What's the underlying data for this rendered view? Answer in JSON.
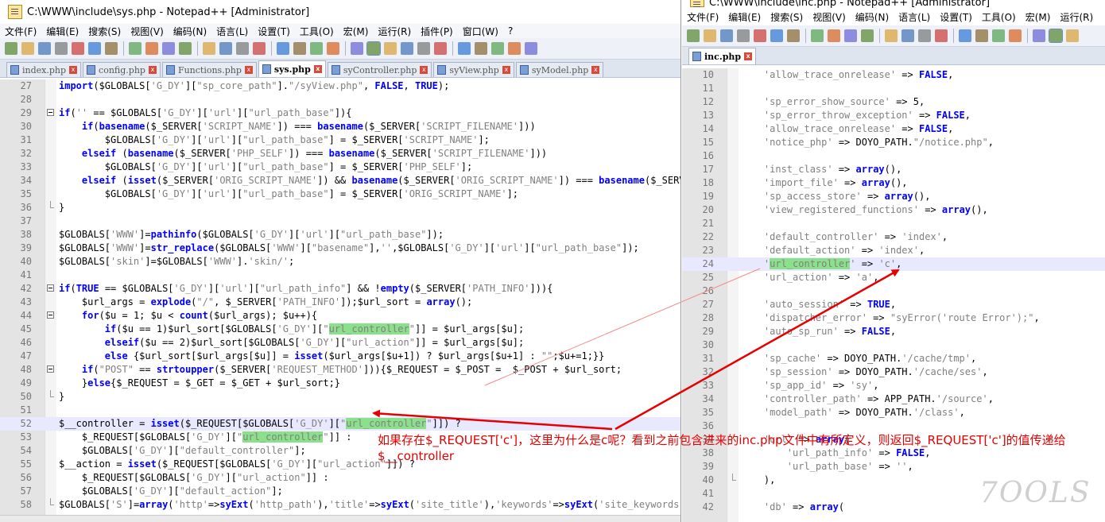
{
  "left": {
    "title": "C:\\WWW\\include\\sys.php - Notepad++ [Administrator]",
    "menus": [
      "文件(F)",
      "编辑(E)",
      "搜索(S)",
      "视图(V)",
      "编码(N)",
      "语言(L)",
      "设置(T)",
      "工具(O)",
      "宏(M)",
      "运行(R)",
      "插件(P)",
      "窗口(W)",
      "?"
    ],
    "tabs": [
      {
        "label": "index.php",
        "active": false
      },
      {
        "label": "config.php",
        "active": false
      },
      {
        "label": "Functions.php",
        "active": false
      },
      {
        "label": "sys.php",
        "active": true
      },
      {
        "label": "syController.php",
        "active": false
      },
      {
        "label": "syView.php",
        "active": false
      },
      {
        "label": "syModel.php",
        "active": false
      }
    ],
    "lines": [
      {
        "n": "27",
        "t": "import($GLOBALS['G_DY'][\"sp_core_path\"].\"/syView.php\", FALSE, TRUE);"
      },
      {
        "n": "28",
        "t": ""
      },
      {
        "n": "29",
        "t": "if('' == $GLOBALS['G_DY']['url'][\"url_path_base\"]){"
      },
      {
        "n": "30",
        "t": "    if(basename($_SERVER['SCRIPT_NAME']) === basename($_SERVER['SCRIPT_FILENAME']))"
      },
      {
        "n": "31",
        "t": "        $GLOBALS['G_DY']['url'][\"url_path_base\"] = $_SERVER['SCRIPT_NAME'];"
      },
      {
        "n": "32",
        "t": "    elseif (basename($_SERVER['PHP_SELF']) === basename($_SERVER['SCRIPT_FILENAME']))"
      },
      {
        "n": "33",
        "t": "        $GLOBALS['G_DY']['url'][\"url_path_base\"] = $_SERVER['PHP_SELF'];"
      },
      {
        "n": "34",
        "t": "    elseif (isset($_SERVER['ORIG_SCRIPT_NAME']) && basename($_SERVER['ORIG_SCRIPT_NAME']) === basename($_SERVER['SCRIPT_FILENAME']))"
      },
      {
        "n": "35",
        "t": "        $GLOBALS['G_DY']['url'][\"url_path_base\"] = $_SERVER['ORIG_SCRIPT_NAME'];"
      },
      {
        "n": "36",
        "t": "}"
      },
      {
        "n": "37",
        "t": ""
      },
      {
        "n": "38",
        "t": "$GLOBALS['WWW']=pathinfo($GLOBALS['G_DY']['url'][\"url_path_base\"]);"
      },
      {
        "n": "39",
        "t": "$GLOBALS['WWW']=str_replace($GLOBALS['WWW'][\"basename\"],'',$GLOBALS['G_DY']['url'][\"url_path_base\"]);"
      },
      {
        "n": "40",
        "t": "$GLOBALS['skin']=$GLOBALS['WWW'].'skin/';"
      },
      {
        "n": "41",
        "t": ""
      },
      {
        "n": "42",
        "t": "if(TRUE == $GLOBALS['G_DY']['url'][\"url_path_info\"] && !empty($_SERVER['PATH_INFO'])){"
      },
      {
        "n": "43",
        "t": "    $url_args = explode(\"/\", $_SERVER['PATH_INFO']);$url_sort = array();"
      },
      {
        "n": "44",
        "t": "    for($u = 1; $u < count($url_args); $u++){"
      },
      {
        "n": "45",
        "t": "        if($u == 1)$url_sort[$GLOBALS['G_DY'][\"url_controller\"]] = $url_args[$u];"
      },
      {
        "n": "46",
        "t": "        elseif($u == 2)$url_sort[$GLOBALS['G_DY'][\"url_action\"]] = $url_args[$u];"
      },
      {
        "n": "47",
        "t": "        else {$url_sort[$url_args[$u]] = isset($url_args[$u+1]) ? $url_args[$u+1] : \"\";$u+=1;}}"
      },
      {
        "n": "48",
        "t": "    if(\"POST\" == strtoupper($_SERVER['REQUEST_METHOD'])){$_REQUEST = $_POST =  $_POST + $url_sort;"
      },
      {
        "n": "49",
        "t": "    }else{$_REQUEST = $_GET = $_GET + $url_sort;}"
      },
      {
        "n": "50",
        "t": "}"
      },
      {
        "n": "51",
        "t": ""
      },
      {
        "n": "52",
        "t": "$__controller = isset($_REQUEST[$GLOBALS['G_DY'][\"url_controller\"]]) ?"
      },
      {
        "n": "53",
        "t": "    $_REQUEST[$GLOBALS['G_DY'][\"url_controller\"]] :"
      },
      {
        "n": "54",
        "t": "    $GLOBALS['G_DY'][\"default_controller\"];"
      },
      {
        "n": "55",
        "t": "$__action = isset($_REQUEST[$GLOBALS['G_DY'][\"url_action\"]]) ?"
      },
      {
        "n": "56",
        "t": "    $_REQUEST[$GLOBALS['G_DY'][\"url_action\"]] :"
      },
      {
        "n": "57",
        "t": "    $GLOBALS['G_DY'][\"default_action\"];"
      },
      {
        "n": "58",
        "t": "$GLOBALS['S']=array('http'=>syExt('http_path'),'title'=>syExt('site_title'),'keywords'=>syExt('site_keywords'));"
      }
    ]
  },
  "right": {
    "title": "C:\\WWW\\include\\inc.php - Notepad++ [Administrator]",
    "menus": [
      "文件(F)",
      "编辑(E)",
      "搜索(S)",
      "视图(V)",
      "编码(N)",
      "语言(L)",
      "设置(T)",
      "工具(O)",
      "宏(M)",
      "运行(R)"
    ],
    "tabs": [
      {
        "label": "inc.php",
        "active": true
      }
    ],
    "lines": [
      {
        "n": "10",
        "t": "    'allow_trace_onrelease' => FALSE,"
      },
      {
        "n": "11",
        "t": ""
      },
      {
        "n": "12",
        "t": "    'sp_error_show_source' => 5,"
      },
      {
        "n": "13",
        "t": "    'sp_error_throw_exception' => FALSE,"
      },
      {
        "n": "14",
        "t": "    'allow_trace_onrelease' => FALSE,"
      },
      {
        "n": "15",
        "t": "    'notice_php' => DOYO_PATH.\"/notice.php\","
      },
      {
        "n": "16",
        "t": ""
      },
      {
        "n": "17",
        "t": "    'inst_class' => array(),"
      },
      {
        "n": "18",
        "t": "    'import_file' => array(),"
      },
      {
        "n": "19",
        "t": "    'sp_access_store' => array(),"
      },
      {
        "n": "20",
        "t": "    'view_registered_functions' => array(),"
      },
      {
        "n": "21",
        "t": ""
      },
      {
        "n": "22",
        "t": "    'default_controller' => 'index',"
      },
      {
        "n": "23",
        "t": "    'default_action' => 'index',"
      },
      {
        "n": "24",
        "t": "    'url_controller' => 'c',"
      },
      {
        "n": "25",
        "t": "    'url_action' => 'a',"
      },
      {
        "n": "26",
        "t": ""
      },
      {
        "n": "27",
        "t": "    'auto_session' => TRUE,"
      },
      {
        "n": "28",
        "t": "    'dispatcher_error' => \"syError('route Error');\","
      },
      {
        "n": "29",
        "t": "    'auto_sp_run' => FALSE,"
      },
      {
        "n": "30",
        "t": ""
      },
      {
        "n": "31",
        "t": "    'sp_cache' => DOYO_PATH.'/cache/tmp',"
      },
      {
        "n": "32",
        "t": "    'sp_session' => DOYO_PATH.'/cache/ses',"
      },
      {
        "n": "33",
        "t": "    'sp_app_id' => 'sy',"
      },
      {
        "n": "34",
        "t": "    'controller_path' => APP_PATH.'/source',"
      },
      {
        "n": "35",
        "t": "    'model_path' => DOYO_PATH.'/class',"
      },
      {
        "n": "36",
        "t": ""
      },
      {
        "n": "37",
        "t": "    'url' => array("
      },
      {
        "n": "38",
        "t": "        'url_path_info' => FALSE,"
      },
      {
        "n": "39",
        "t": "        'url_path_base' => '',"
      },
      {
        "n": "40",
        "t": "    ),"
      },
      {
        "n": "41",
        "t": ""
      },
      {
        "n": "42",
        "t": "    'db' => array("
      }
    ]
  },
  "annotation": "如果存在$_REQUEST['c']，这里为什么是c呢？看到之前包含进来的inc.php文件中有所定义，则返回$_REQUEST['c']的值传递给$__controller",
  "watermark": "7OOLS",
  "colors": {
    "keyword": "#0000ff",
    "string": "#808080",
    "highlight": "#8be08b",
    "arrow": "#e60000",
    "currentLine": "#e8e8ff"
  }
}
